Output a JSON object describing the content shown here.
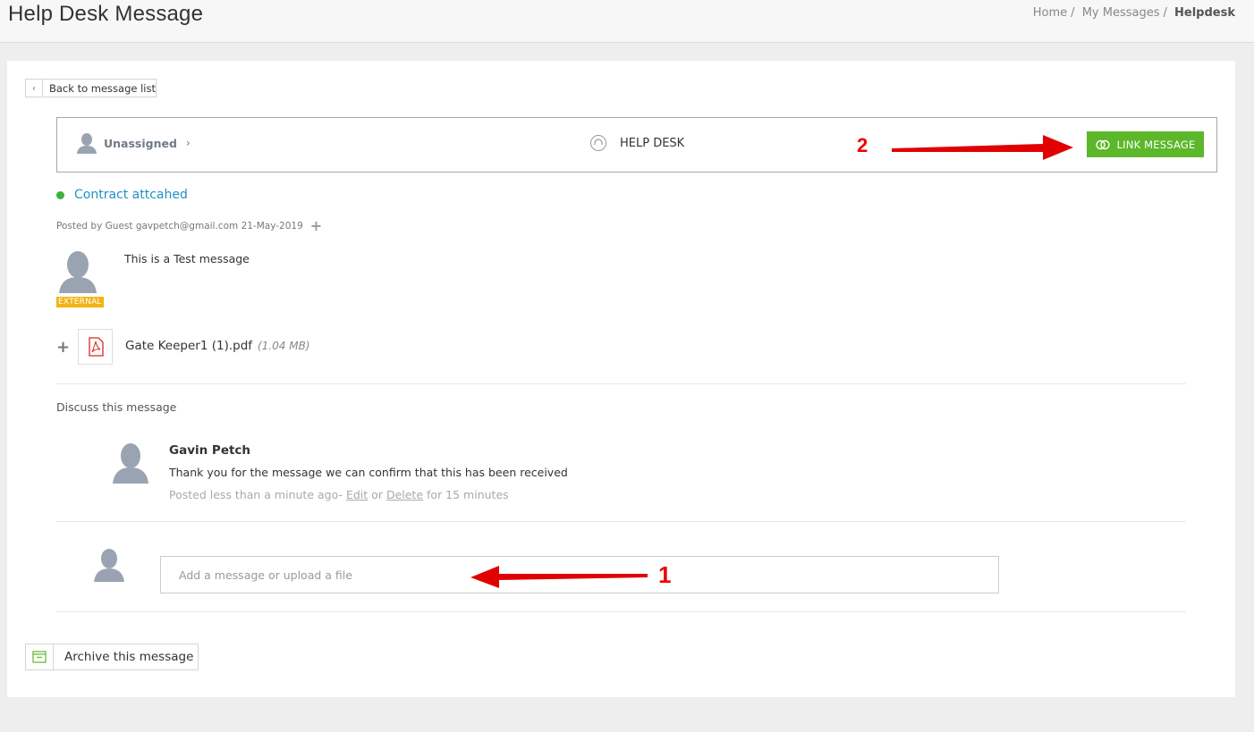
{
  "header": {
    "title": "Help Desk Message",
    "breadcrumb": [
      "Home",
      "My Messages",
      "Helpdesk"
    ],
    "breadcrumb_sep": "/"
  },
  "back_button": {
    "label": "Back to message list",
    "icon": "chevron-left-icon"
  },
  "info_bar": {
    "assignee_label": "Unassigned",
    "department_label": "HELP DESK",
    "link_button_label": "LINK MESSAGE"
  },
  "message": {
    "subject": "Contract attcahed",
    "posted_by": "Posted by Guest gavpetch@gmail.com 21-May-2019",
    "badge": "EXTERNAL",
    "body": "This is a Test message",
    "attachment": {
      "name": "Gate Keeper1 (1).pdf",
      "size": "(1.04 MB)",
      "icon": "pdf-icon"
    }
  },
  "discussion": {
    "title": "Discuss this message",
    "comments": [
      {
        "author": "Gavin Petch",
        "text": "Thank you for the message we can confirm that this has been received",
        "meta_prefix": "Posted less than a minute ago-",
        "edit_label": "Edit",
        "or_label": "or",
        "delete_label": "Delete",
        "meta_suffix": "for 15 minutes"
      }
    ],
    "input_placeholder": "Add a message or upload a file"
  },
  "archive_button": {
    "label": "Archive this message",
    "icon": "archive-icon"
  },
  "annotations": {
    "label_1": "1",
    "label_2": "2"
  },
  "colors": {
    "accent_green": "#5cb82a",
    "link_blue": "#1f91c6",
    "badge_yellow": "#f2b315",
    "annotation_red": "#e00000"
  }
}
